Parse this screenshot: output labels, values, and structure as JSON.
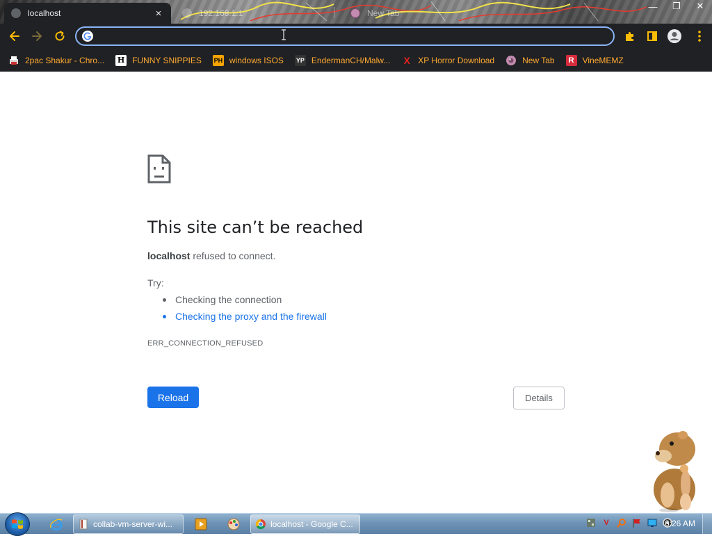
{
  "browser": {
    "tabs": [
      {
        "title": "localhost",
        "active": true
      },
      {
        "title": "192.168.1.1",
        "active": false
      },
      {
        "title": "New Tab",
        "active": false
      }
    ],
    "tab_close_glyph": "×",
    "window_controls": {
      "minimize": "—",
      "restore": "❐",
      "close": "✕"
    },
    "address_bar": {
      "value": "",
      "placeholder": ""
    },
    "accent_color": "#8ab4f8",
    "toolbar_bg": "#202124"
  },
  "bookmarks": [
    {
      "label": "2pac Shakur - Chro...",
      "icon": "printer-icon"
    },
    {
      "label": "FUNNY SNIPPIES",
      "icon": "H"
    },
    {
      "label": "windows ISOS",
      "icon": "PH"
    },
    {
      "label": "EndermanCH/Malw...",
      "icon": "YP"
    },
    {
      "label": "XP Horror Download",
      "icon": "X"
    },
    {
      "label": "New Tab",
      "icon": "globe-icon"
    },
    {
      "label": "VineMEMZ",
      "icon": "R"
    }
  ],
  "error_page": {
    "title": "This site can’t be reached",
    "host": "localhost",
    "message_rest": " refused to connect.",
    "try_label": "Try:",
    "suggestions": [
      {
        "text": "Checking the connection",
        "link": false
      },
      {
        "text": "Checking the proxy and the firewall",
        "link": true
      }
    ],
    "error_code": "ERR_CONNECTION_REFUSED",
    "reload_label": "Reload",
    "details_label": "Details",
    "button_color": "#1a73e8"
  },
  "taskbar": {
    "tasks": [
      {
        "label": "collab-vm-server-wi...",
        "active": false
      },
      {
        "label": "localhost - Google C...",
        "active": true
      }
    ],
    "clock": "6:26 AM"
  }
}
